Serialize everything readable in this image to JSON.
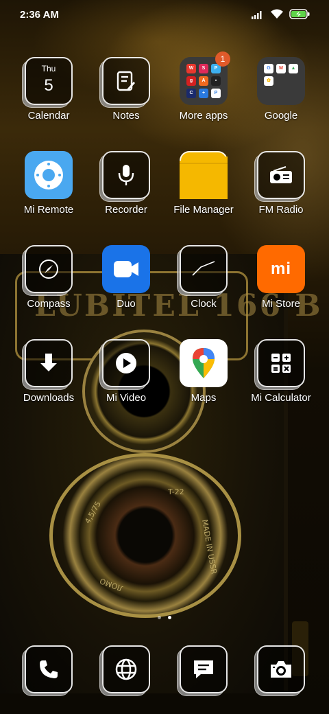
{
  "status_bar": {
    "time": "2:36 AM"
  },
  "wallpaper": {
    "lens_text_1": "4,5/75",
    "lens_text_2": "T-22",
    "lens_text_3": "MADE IN USSR",
    "lens_text_4": "ЛОМО"
  },
  "apps": [
    {
      "label": "Calendar",
      "icon": "calendar-icon",
      "day": "Thu",
      "date": "5"
    },
    {
      "label": "Notes",
      "icon": "notes-icon"
    },
    {
      "label": "More apps",
      "icon": "folder-icon",
      "badge": "1"
    },
    {
      "label": "Google",
      "icon": "folder-icon"
    },
    {
      "label": "Mi Remote",
      "icon": "remote-icon"
    },
    {
      "label": "Recorder",
      "icon": "microphone-icon"
    },
    {
      "label": "File Manager",
      "icon": "folder-yellow-icon"
    },
    {
      "label": "FM Radio",
      "icon": "radio-icon"
    },
    {
      "label": "Compass",
      "icon": "compass-icon"
    },
    {
      "label": "Duo",
      "icon": "video-camera-icon"
    },
    {
      "label": "Clock",
      "icon": "clock-icon"
    },
    {
      "label": "Mi Store",
      "icon": "mi-logo-icon",
      "logo": "mi"
    },
    {
      "label": "Downloads",
      "icon": "download-icon"
    },
    {
      "label": "Mi Video",
      "icon": "play-icon"
    },
    {
      "label": "Maps",
      "icon": "maps-pin-icon"
    },
    {
      "label": "Mi Calculator",
      "icon": "calculator-icon"
    }
  ],
  "dock": [
    {
      "icon": "phone-icon"
    },
    {
      "icon": "globe-icon"
    },
    {
      "icon": "message-icon"
    },
    {
      "icon": "camera-icon"
    }
  ],
  "colors": {
    "remote_bg": "#4aa8f0",
    "duo_bg": "#1a73e8",
    "files_bg": "#f5b800",
    "mistore_bg": "#ff6a00",
    "badge": "#e05a2a"
  }
}
